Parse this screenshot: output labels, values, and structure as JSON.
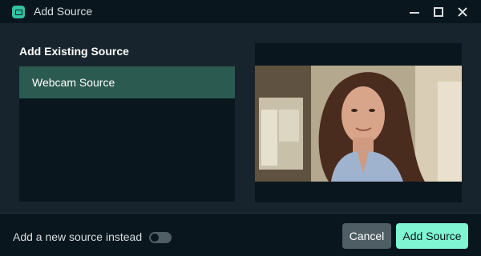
{
  "window": {
    "title": "Add Source",
    "controls": {
      "minimize_icon": "minimize-icon",
      "maximize_icon": "maximize-icon",
      "close_icon": "close-icon"
    },
    "app_icon": "streamlabs-app-icon"
  },
  "existing_sources": {
    "heading": "Add Existing Source",
    "items": [
      {
        "label": "Webcam Source",
        "selected": true
      }
    ]
  },
  "preview": {
    "content": "webcam-preview-image"
  },
  "footer": {
    "toggle_label": "Add a new source instead",
    "toggle_on": false,
    "cancel_label": "Cancel",
    "add_label": "Add Source"
  },
  "colors": {
    "accent": "#80f5d2",
    "selected_item": "#2b5a50",
    "panel_bg": "#17242d",
    "dark_bg": "#09161d",
    "button_secondary": "#4f5e65"
  }
}
